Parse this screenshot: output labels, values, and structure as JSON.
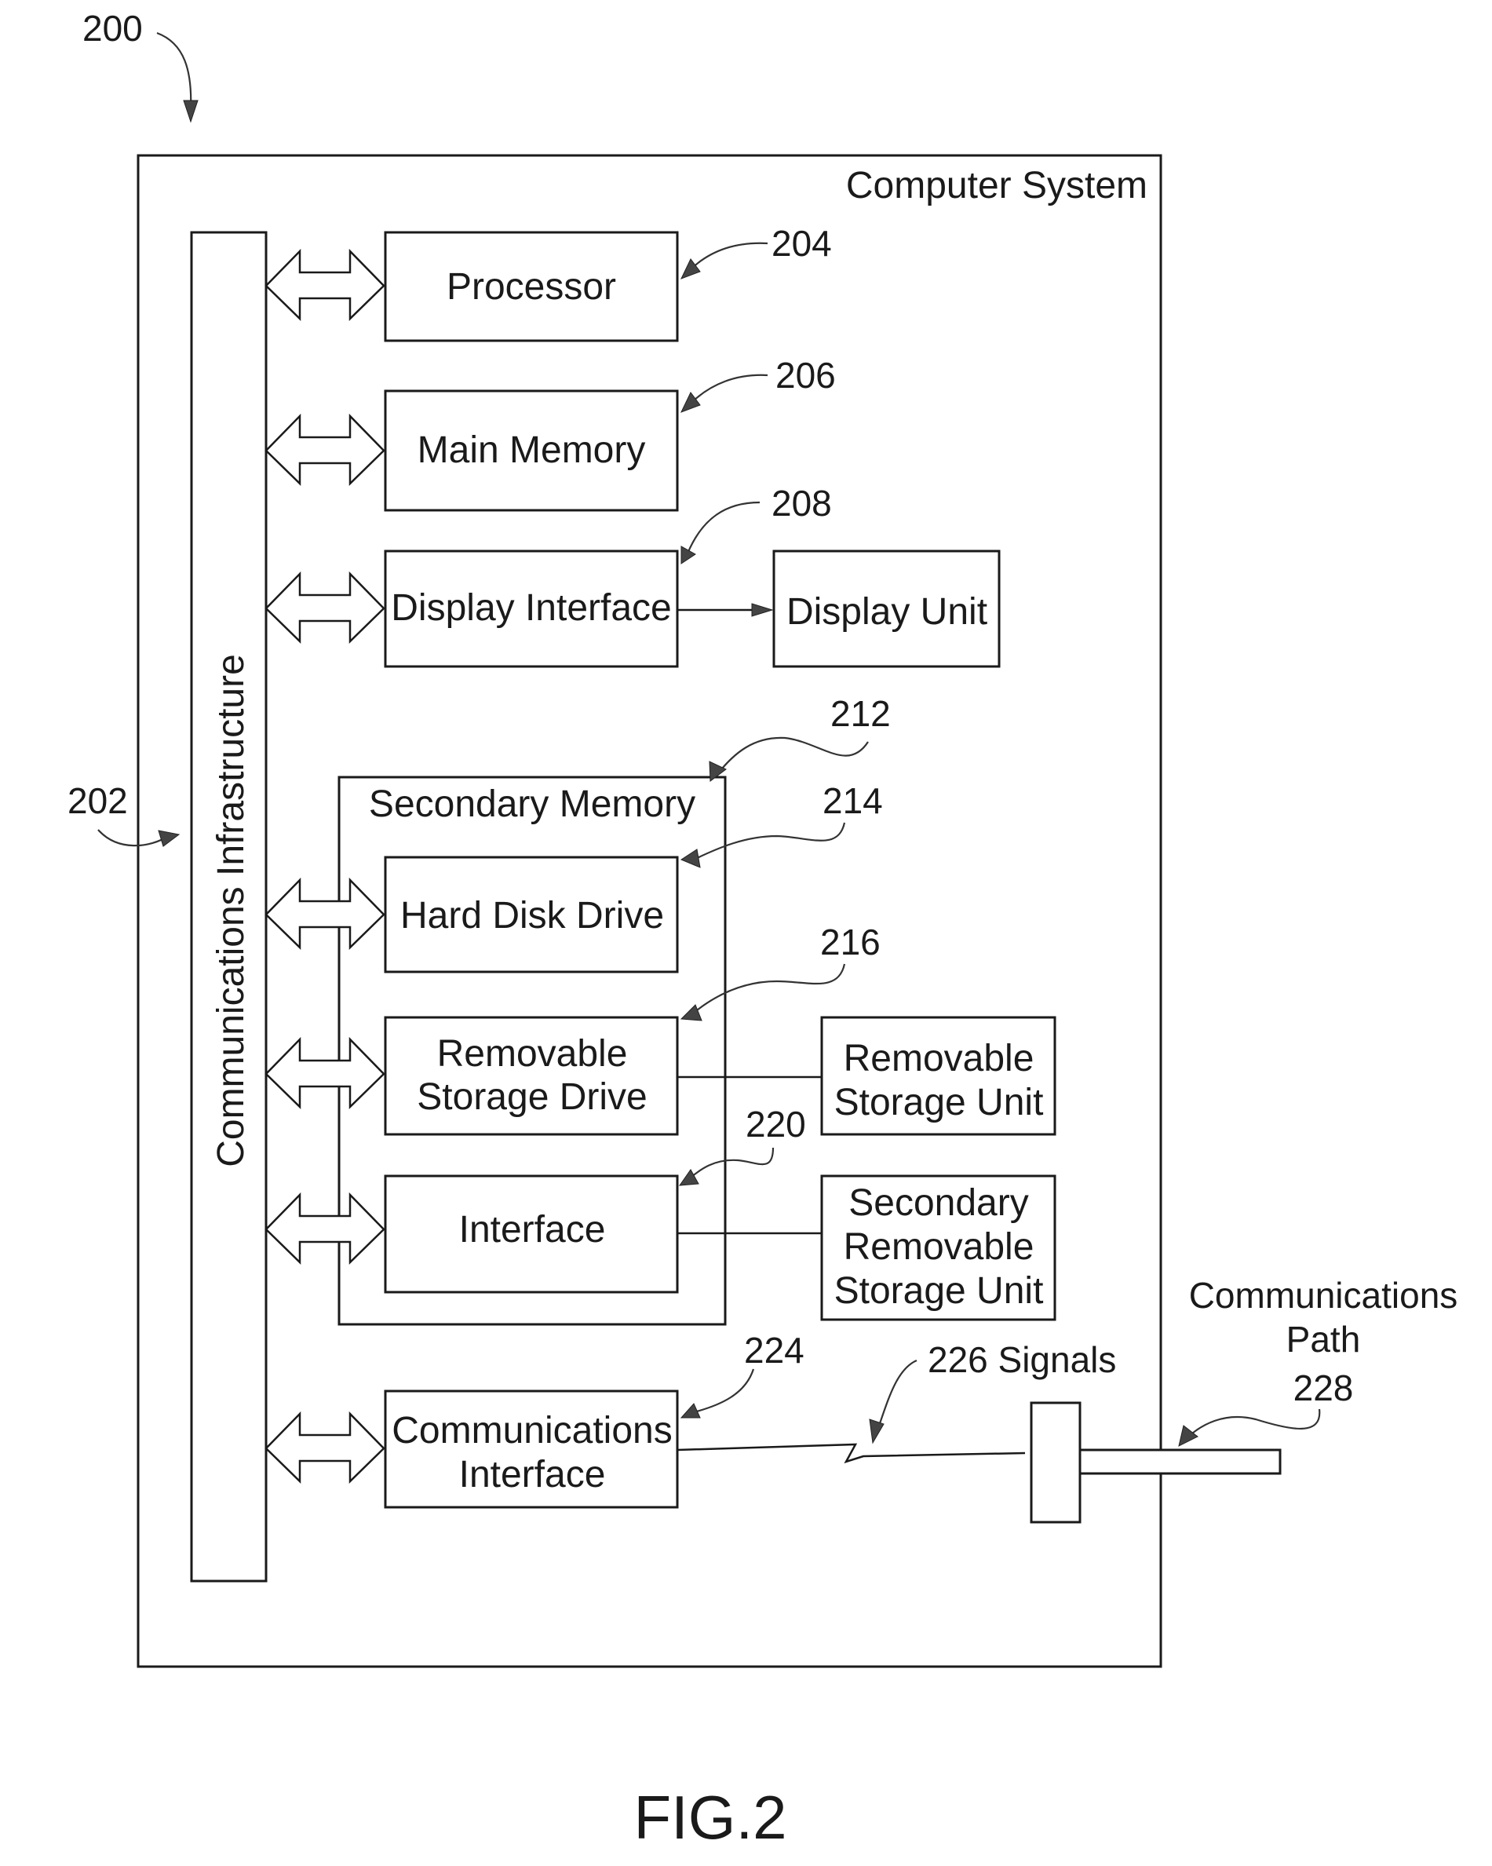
{
  "figure": {
    "ref_number": "200",
    "caption": "FIG.2"
  },
  "computer_system": {
    "title": "Computer System"
  },
  "infrastructure": {
    "label": "Communications Infrastructure",
    "ref": "202"
  },
  "blocks": {
    "processor": {
      "label": "Processor",
      "ref": "204"
    },
    "main_memory": {
      "label": "Main Memory",
      "ref": "206"
    },
    "display_interface": {
      "label": "Display Interface",
      "ref": "208"
    },
    "display_unit": {
      "label": "Display Unit"
    },
    "secondary_memory": {
      "label": "Secondary Memory",
      "ref": "212"
    },
    "hard_disk_drive": {
      "label": "Hard Disk Drive",
      "ref": "214"
    },
    "removable_storage_drive": {
      "line1": "Removable",
      "line2": "Storage Drive",
      "ref": "216"
    },
    "removable_storage_unit": {
      "line1": "Removable",
      "line2": "Storage Unit"
    },
    "interface": {
      "label": "Interface",
      "ref": "220"
    },
    "secondary_removable_storage_unit": {
      "line1": "Secondary",
      "line2": "Removable",
      "line3": "Storage Unit"
    },
    "communications_interface": {
      "line1": "Communications",
      "line2": "Interface",
      "ref": "224"
    }
  },
  "signals": {
    "label": "226 Signals"
  },
  "communications_path": {
    "line1": "Communications",
    "line2": "Path",
    "ref": "228"
  }
}
